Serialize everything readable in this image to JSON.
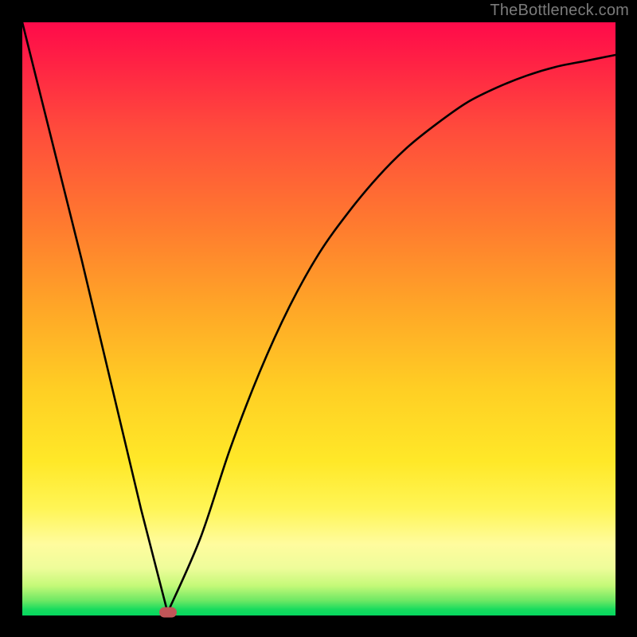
{
  "watermark": "TheBottleneck.com",
  "colors": {
    "background": "#000000",
    "curve": "#000000",
    "dot": "#c15658"
  },
  "chart_data": {
    "type": "line",
    "title": "",
    "xlabel": "",
    "ylabel": "",
    "xlim": [
      0,
      100
    ],
    "ylim": [
      0,
      100
    ],
    "series": [
      {
        "name": "bottleneck-curve",
        "x": [
          0,
          5,
          10,
          15,
          20,
          24.5,
          30,
          35,
          40,
          45,
          50,
          55,
          60,
          65,
          70,
          75,
          80,
          85,
          90,
          95,
          100
        ],
        "values": [
          100,
          80,
          60,
          39,
          18,
          0.5,
          13,
          28,
          41,
          52,
          61,
          68,
          74,
          79,
          83,
          86.5,
          89,
          91,
          92.5,
          93.5,
          94.5
        ]
      }
    ],
    "marker": {
      "x": 24.5,
      "y": 0.5
    },
    "gradient_stops": [
      {
        "pos": 0.0,
        "color": "#ff0a4a"
      },
      {
        "pos": 0.34,
        "color": "#ff7a2f"
      },
      {
        "pos": 0.62,
        "color": "#ffcf24"
      },
      {
        "pos": 0.88,
        "color": "#fffc9e"
      },
      {
        "pos": 1.0,
        "color": "#05d85f"
      }
    ]
  }
}
